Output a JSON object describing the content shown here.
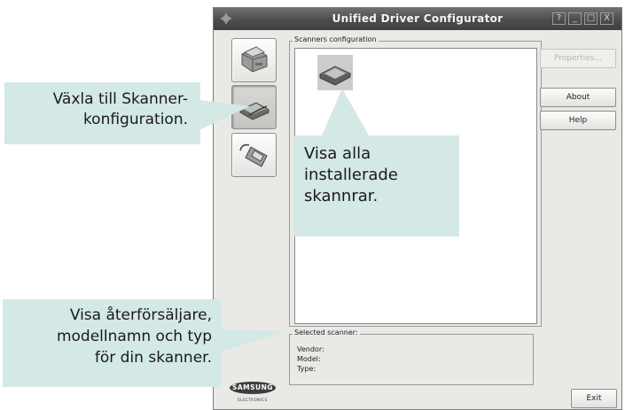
{
  "window": {
    "title": "Unified Driver Configurator",
    "controls": [
      "?",
      "_",
      "□",
      "X"
    ]
  },
  "nav": [
    {
      "icon": "printer-icon",
      "active": false
    },
    {
      "icon": "scanner-icon",
      "active": true
    },
    {
      "icon": "port-icon",
      "active": false
    }
  ],
  "scanners_frame": {
    "label": "Scanners configuration"
  },
  "buttons": {
    "properties": "Properties...",
    "about": "About",
    "help": "Help",
    "exit": "Exit"
  },
  "selected_scanner": {
    "label": "Selected scanner:",
    "vendor": "Vendor:",
    "model": "Model:",
    "type": "Type:"
  },
  "logo": {
    "brand": "SAMSUNG",
    "sub": "ELECTRONICS"
  },
  "callouts": {
    "switch": [
      "Växla till Skanner-",
      "konfiguration."
    ],
    "scanners": [
      "Visa alla",
      "installerade",
      "skannrar."
    ],
    "info": [
      "Visa återförsäljare,",
      "modellnamn och typ",
      "för din skanner."
    ]
  },
  "colors": {
    "callout_bg": "#d4e8e6",
    "titlebar": "#4c4c4c",
    "window_bg": "#e9e9e6"
  }
}
